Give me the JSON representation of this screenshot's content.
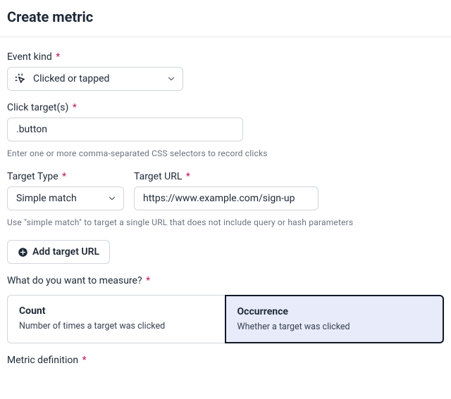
{
  "page": {
    "title": "Create metric"
  },
  "eventKind": {
    "label": "Event kind",
    "value": "Clicked or tapped"
  },
  "clickTargets": {
    "label": "Click target(s)",
    "value": ".button",
    "helper": "Enter one or more comma-separated CSS selectors to record clicks"
  },
  "targetType": {
    "label": "Target Type",
    "value": "Simple match"
  },
  "targetUrl": {
    "label": "Target URL",
    "value": "https://www.example.com/sign-up"
  },
  "targetHelper": "Use \"simple match\" to target a single URL that does not include query or hash parameters",
  "addTargetUrl": "Add target URL",
  "measure": {
    "label": "What do you want to measure?",
    "options": [
      {
        "title": "Count",
        "desc": "Number of times a target was clicked"
      },
      {
        "title": "Occurrence",
        "desc": "Whether a target was clicked"
      }
    ]
  },
  "metricDefinition": {
    "label": "Metric definition"
  },
  "required": "*"
}
